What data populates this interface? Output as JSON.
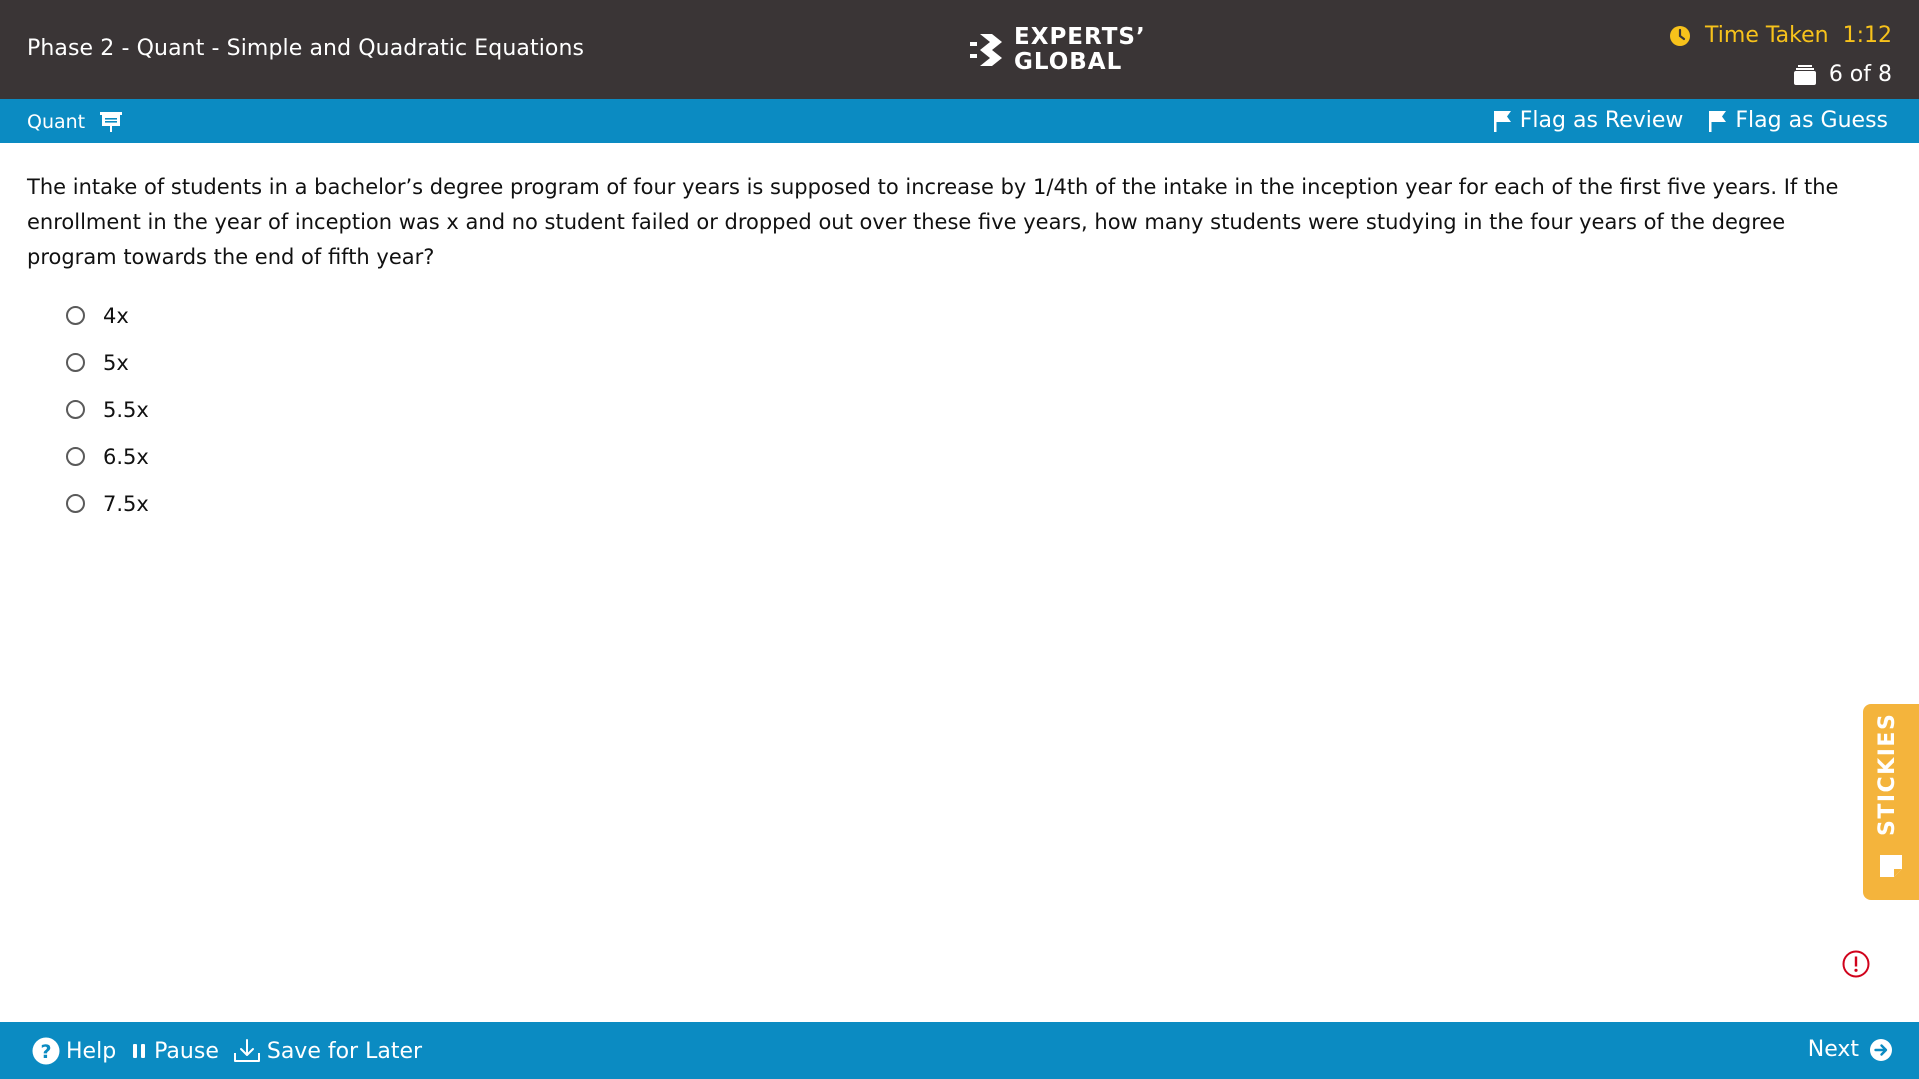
{
  "header": {
    "title": "Phase 2 - Quant - Simple and Quadratic Equations",
    "logo_line1": "EXPERTS’",
    "logo_line2": "GLOBAL",
    "timer_label": "Time Taken",
    "timer_value": "1:12",
    "question_counter": "6 of 8"
  },
  "section_bar": {
    "section_label": "Quant",
    "flag_review": "Flag as Review",
    "flag_guess": "Flag as Guess"
  },
  "question": {
    "text": "The intake of students in a bachelor’s degree program of four years is supposed to increase by 1/4th of the intake in the inception year for each of the first five years. If the enrollment in the year of inception was x and no student failed or dropped out over these five years, how many students were studying in the four years of the degree program towards the end of fifth year?",
    "options": [
      "4x",
      "5x",
      "5.5x",
      "6.5x",
      "7.5x"
    ]
  },
  "stickies": {
    "label": "STICKIES"
  },
  "footer": {
    "help": "Help",
    "pause": "Pause",
    "save_for_later": "Save for Later",
    "next": "Next"
  },
  "colors": {
    "header_bg": "#3a3536",
    "accent_blue": "#0b8bc2",
    "timer_yellow": "#f7c21b",
    "stickies_orange": "#f4b43c",
    "alert_red": "#d0021b"
  },
  "icons": [
    "clock-icon",
    "question-stack-icon",
    "presentation-icon",
    "flag-icon",
    "note-icon",
    "alert-icon",
    "help-icon",
    "pause-icon",
    "download-icon",
    "arrow-right-icon"
  ]
}
